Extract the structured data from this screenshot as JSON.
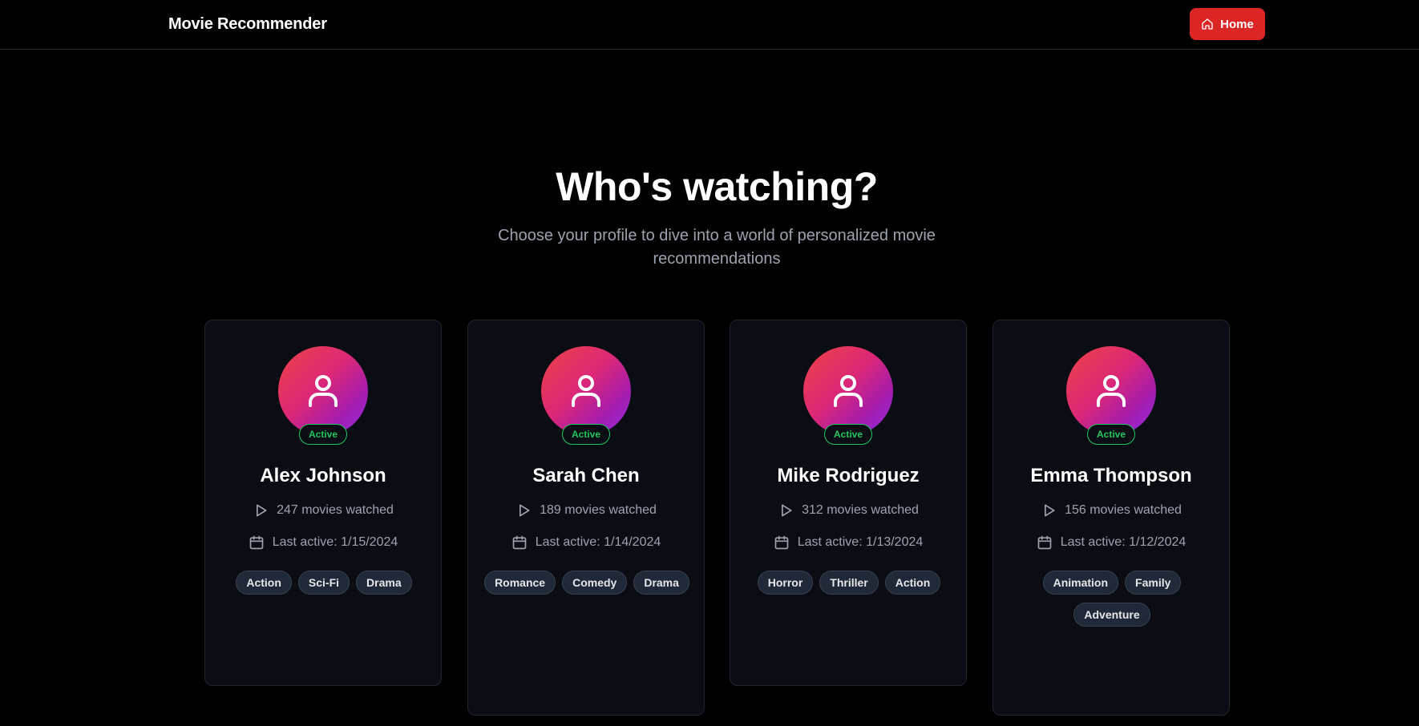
{
  "header": {
    "brand": "Movie Recommender",
    "home_label": "Home"
  },
  "hero": {
    "title": "Who's watching?",
    "subtitle": "Choose your profile to dive into a world of personalized movie recommendations"
  },
  "colors": {
    "accent": "#dc2626",
    "active": "#22c55e",
    "avatar_gradient": [
      "#ef4444",
      "#9333ea"
    ]
  },
  "profiles": [
    {
      "name": "Alex Johnson",
      "status": "Active",
      "movies_watched": "247 movies watched",
      "last_active": "Last active: 1/15/2024",
      "genres": [
        "Action",
        "Sci-Fi",
        "Drama"
      ]
    },
    {
      "name": "Sarah Chen",
      "status": "Active",
      "movies_watched": "189 movies watched",
      "last_active": "Last active: 1/14/2024",
      "genres": [
        "Romance",
        "Comedy",
        "Drama"
      ]
    },
    {
      "name": "Mike Rodriguez",
      "status": "Active",
      "movies_watched": "312 movies watched",
      "last_active": "Last active: 1/13/2024",
      "genres": [
        "Horror",
        "Thriller",
        "Action"
      ]
    },
    {
      "name": "Emma Thompson",
      "status": "Active",
      "movies_watched": "156 movies watched",
      "last_active": "Last active: 1/12/2024",
      "genres": [
        "Animation",
        "Family",
        "Adventure"
      ]
    }
  ]
}
